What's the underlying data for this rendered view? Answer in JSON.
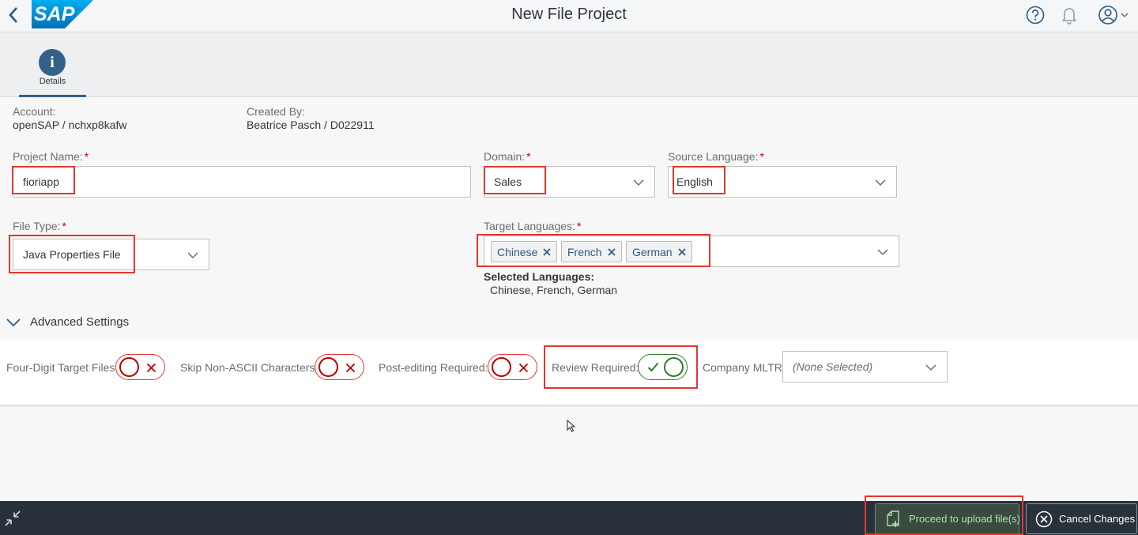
{
  "shell": {
    "title": "New File Project",
    "logo_text": "SAP",
    "icons": [
      "back-icon",
      "help-icon",
      "notification-bell-icon",
      "user-account-icon",
      "chevron-down-icon"
    ]
  },
  "tabs": [
    {
      "icon_glyph": "i",
      "label": "Details"
    }
  ],
  "info": {
    "account_label": "Account:",
    "account_value": "openSAP / nchxp8kafw",
    "created_label": "Created By:",
    "created_value": "Beatrice Pasch / D022911"
  },
  "form": {
    "required_mark": "*",
    "project_name": {
      "label": "Project Name:",
      "value": "fioriapp"
    },
    "domain": {
      "label": "Domain:",
      "value": "Sales"
    },
    "source_language": {
      "label": "Source Language:",
      "value": "English"
    },
    "file_type": {
      "label": "File Type:",
      "value": "Java Properties File"
    },
    "target_languages": {
      "label": "Target Languages:",
      "tokens": [
        "Chinese",
        "French",
        "German"
      ],
      "selected_label": "Selected Languages:",
      "selected_value": "Chinese, French, German"
    }
  },
  "advanced": {
    "title": "Advanced Settings",
    "four_digit": {
      "label": "Four-Digit Target Files:",
      "on": false
    },
    "skip_non_ascii": {
      "label": "Skip Non-ASCII Characters:",
      "on": false
    },
    "post_editing": {
      "label": "Post-editing Required:",
      "on": false
    },
    "review": {
      "label": "Review Required:",
      "on": true
    },
    "company_mltr": {
      "label": "Company MLTR:",
      "value": "(None Selected)"
    }
  },
  "footer": {
    "proceed_label": "Proceed to upload file(s)",
    "cancel_label": "Cancel Changes"
  },
  "colors": {
    "shell_bg": "#f4f6f8",
    "accent": "#346187",
    "highlight": "#e2372f",
    "footer_bg": "#29313a",
    "toggle_on": "#2b7d2b",
    "toggle_off": "#bb0000"
  }
}
